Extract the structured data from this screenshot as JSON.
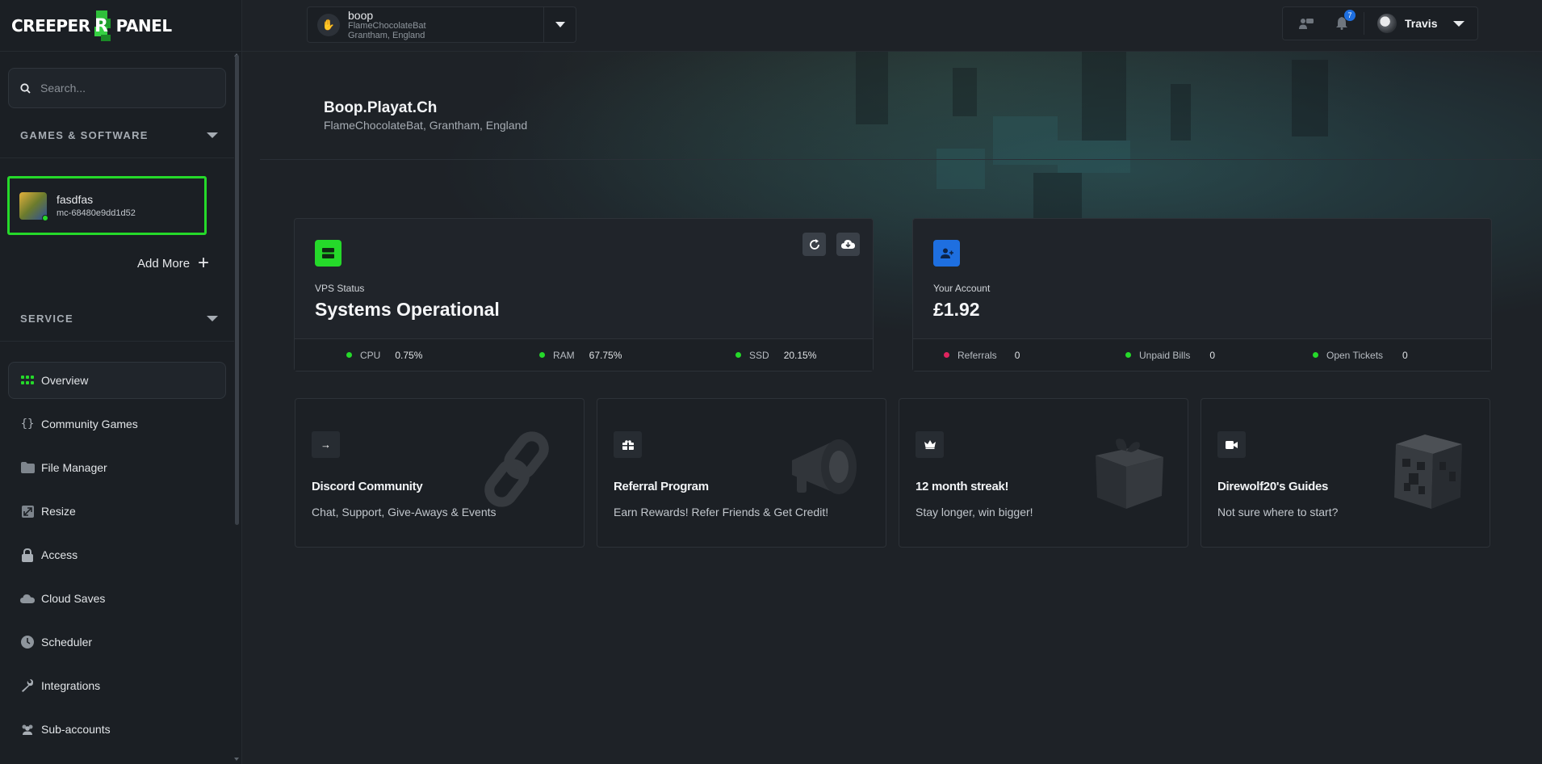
{
  "brand": {
    "left": "CREEPER",
    "right": "PANEL"
  },
  "sidebar": {
    "search_placeholder": "Search...",
    "games_section": "GAMES & SOFTWARE",
    "server": {
      "name": "fasdfas",
      "id": "mc-68480e9dd1d52"
    },
    "add_more": "Add More",
    "service_section": "SERVICE",
    "nav": [
      {
        "label": "Overview",
        "icon": "overview-grid-icon"
      },
      {
        "label": "Community Games",
        "icon": "braces-icon"
      },
      {
        "label": "File Manager",
        "icon": "folder-icon"
      },
      {
        "label": "Resize",
        "icon": "resize-icon"
      },
      {
        "label": "Access",
        "icon": "lock-icon"
      },
      {
        "label": "Cloud Saves",
        "icon": "cloud-icon"
      },
      {
        "label": "Scheduler",
        "icon": "clock-icon"
      },
      {
        "label": "Integrations",
        "icon": "wrench-icon"
      },
      {
        "label": "Sub-accounts",
        "icon": "users-icon"
      }
    ]
  },
  "topbar": {
    "server_select": {
      "name": "boop",
      "line1": "FlameChocolateBat",
      "line2": "Grantham, England"
    },
    "notifications_count": "7",
    "user": "Travis"
  },
  "page": {
    "title": "Boop.Playat.Ch",
    "subtitle": "FlameChocolateBat, Grantham, England"
  },
  "vps": {
    "label": "VPS Status",
    "value": "Systems Operational",
    "metrics": [
      {
        "name": "CPU",
        "value": "0.75%"
      },
      {
        "name": "RAM",
        "value": "67.75%"
      },
      {
        "name": "SSD",
        "value": "20.15%"
      }
    ]
  },
  "account": {
    "label": "Your Account",
    "value": "£1.92",
    "metrics": [
      {
        "name": "Referrals",
        "value": "0",
        "color": "#e0245e"
      },
      {
        "name": "Unpaid Bills",
        "value": "0",
        "color": "#25d92a"
      },
      {
        "name": "Open Tickets",
        "value": "0",
        "color": "#25d92a"
      }
    ]
  },
  "promos": [
    {
      "title": "Discord Community",
      "desc": "Chat, Support, Give-Aways & Events",
      "icon": "arrow-right-icon"
    },
    {
      "title": "Referral Program",
      "desc": "Earn Rewards! Refer Friends & Get Credit!",
      "icon": "gift-box-icon"
    },
    {
      "title": "12 month streak!",
      "desc": "Stay longer, win bigger!",
      "icon": "crown-icon"
    },
    {
      "title": "Direwolf20's Guides",
      "desc": "Not sure where to start?",
      "icon": "video-icon"
    }
  ],
  "colors": {
    "accent_green": "#25d92a",
    "accent_blue": "#1e6fe0",
    "bg": "#1e2227"
  }
}
